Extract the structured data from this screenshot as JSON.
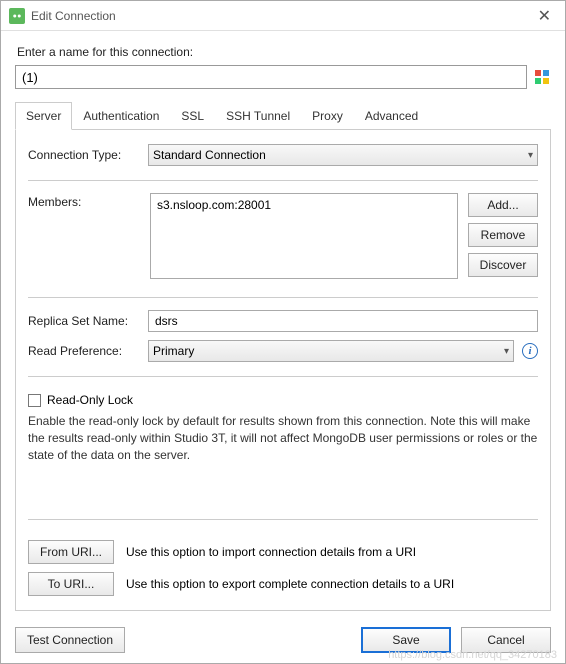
{
  "titlebar": {
    "title": "Edit Connection"
  },
  "prompt": "Enter a name for this connection:",
  "name_value": "(1)",
  "tabs": {
    "server": "Server",
    "auth": "Authentication",
    "ssl": "SSL",
    "ssh": "SSH Tunnel",
    "proxy": "Proxy",
    "advanced": "Advanced"
  },
  "server": {
    "conn_type_label": "Connection Type:",
    "conn_type_value": "Standard Connection",
    "members_label": "Members:",
    "members_item0": "s3.nsloop.com:28001",
    "add_btn": "Add...",
    "remove_btn": "Remove",
    "discover_btn": "Discover",
    "replica_label": "Replica Set Name:",
    "replica_value": "dsrs",
    "readpref_label": "Read Preference:",
    "readpref_value": "Primary",
    "readonly_label": "Read-Only Lock",
    "readonly_desc": "Enable the read-only lock by default for results shown from this connection. Note this will make the results read-only within Studio 3T, it will not affect MongoDB user permissions or roles or the state of the data on the server.",
    "from_uri_btn": "From URI...",
    "from_uri_desc": "Use this option to import connection details from a URI",
    "to_uri_btn": "To URI...",
    "to_uri_desc": "Use this option to export complete connection details to a URI"
  },
  "footer": {
    "test": "Test Connection",
    "save": "Save",
    "cancel": "Cancel"
  },
  "watermark": "https://blog.csdn.net/qq_34270183"
}
